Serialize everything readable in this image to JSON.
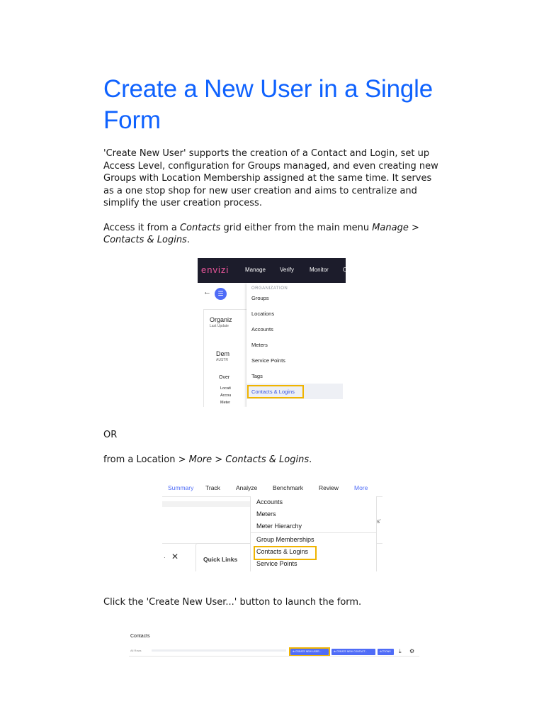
{
  "title": "Create a New User in a Single Form",
  "intro": "'Create New User' supports the creation of a Contact and Login, set up Access Level, configuration for Groups managed, and even creating new Groups with Location Membership assigned at the same time. It serves as a one stop shop for new user creation and aims to centralize and simplify the user creation process.",
  "access": {
    "prefix": "Access it from a ",
    "contacts": "Contacts",
    "middle": " grid either from the main menu ",
    "path": "Manage > Contacts & Logins",
    "suffix": "."
  },
  "or_text": "OR",
  "location": {
    "prefix": "from a Location > ",
    "path": "More > Contacts & Logins",
    "suffix": "."
  },
  "click_text": "Click the 'Create New User...' button to launch the form.",
  "screenshot1": {
    "logo": "envizi",
    "nav": [
      "Manage",
      "Verify",
      "Monitor",
      "C"
    ],
    "org_partial": "Organiz",
    "last_update": "Last Update",
    "demo": "Dem",
    "austr": "AUSTR",
    "over": "Over",
    "side": [
      "Locati",
      "Accou",
      "Meter"
    ],
    "menu_heading": "ORGANIZATION",
    "menu_items": [
      "Groups",
      "Locations",
      "Accounts",
      "Meters",
      "Service Points",
      "Tags",
      "Contacts & Logins"
    ]
  },
  "screenshot2": {
    "tabs": [
      "Summary",
      "Track",
      "Analyze",
      "Benchmark",
      "Review",
      "More"
    ],
    "menu_items": [
      "Accounts",
      "Meters",
      "Meter Hierarchy",
      "Group Memberships",
      "Contacts & Logins",
      "Service Points"
    ],
    "quick_links": "Quick Links",
    "close": "✕",
    "dots": "·",
    "trunc": "s'"
  },
  "screenshot3": {
    "title": "Contacts",
    "rows": "All Rows",
    "buttons": [
      "⊕ CREATE NEW USER...",
      "⊕ CREATE NEW CONTACT...",
      "ACTIONS"
    ],
    "download_icon": "⤓",
    "gear_icon": "⚙"
  },
  "colors": {
    "title": "#0f62fe",
    "accent_blue": "#4f6cf7",
    "highlight": "#f0b400",
    "envizi_pink": "#e8559a"
  }
}
